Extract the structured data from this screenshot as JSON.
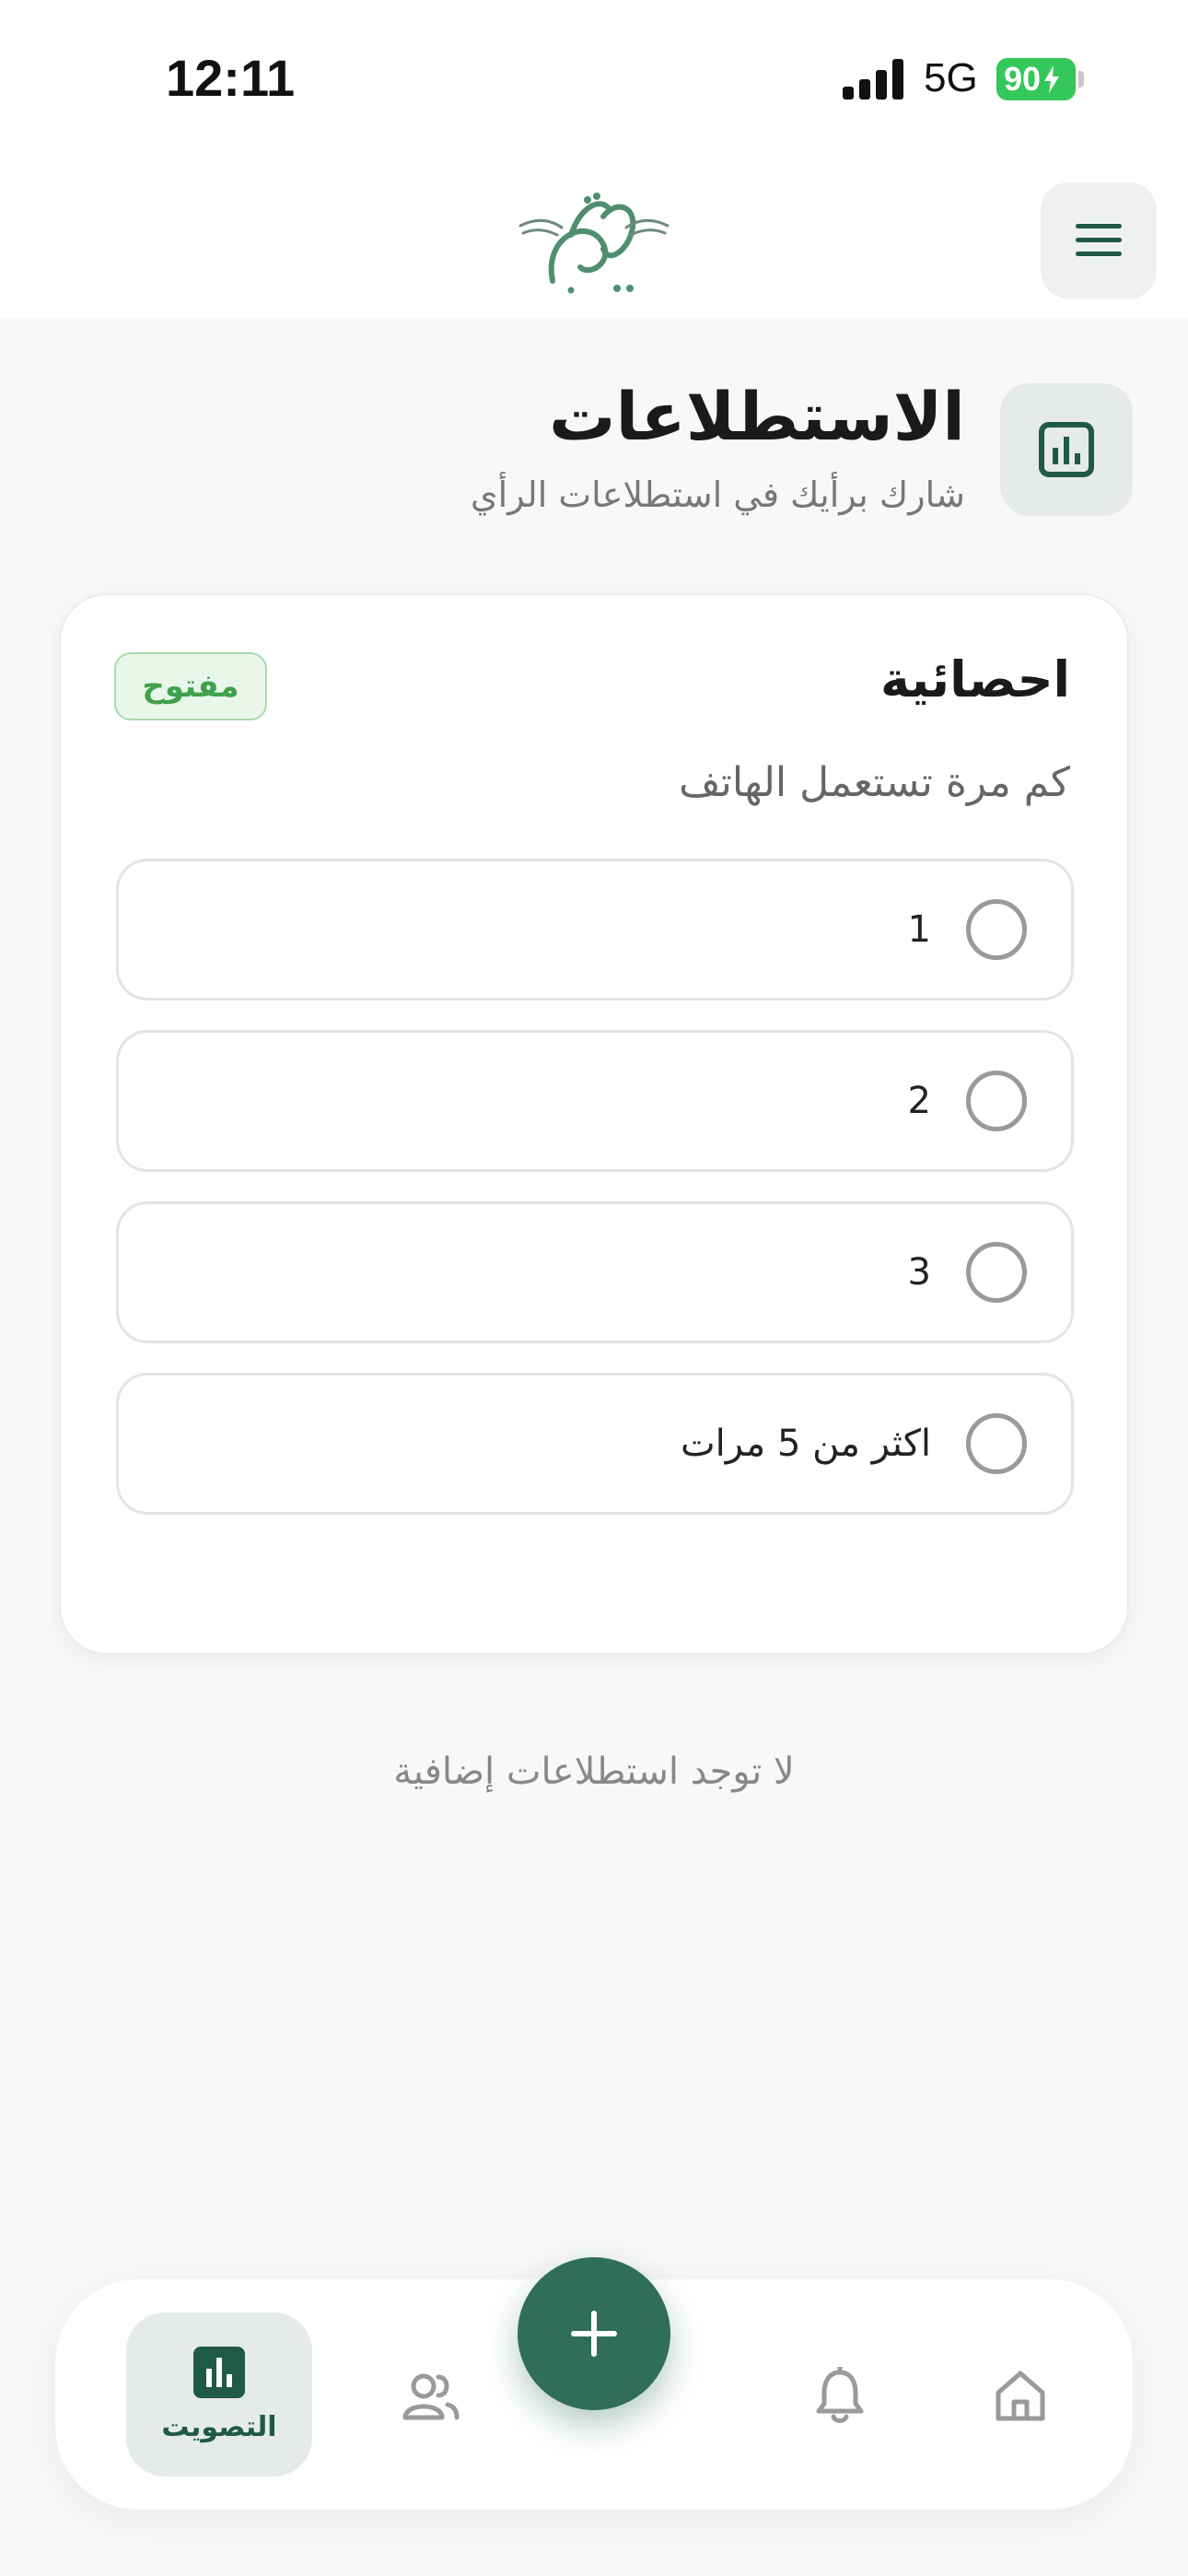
{
  "status_bar": {
    "time": "12:11",
    "network": "5G",
    "battery": "90"
  },
  "header": {
    "logo_icon": "calligraphy-logo",
    "menu_icon": "hamburger-menu-icon"
  },
  "page": {
    "icon": "bar-chart-icon",
    "title": "الاستطلاعات",
    "subtitle": "شارك برأيك في استطلاعات الرأي"
  },
  "poll": {
    "title": "احصائية",
    "status": "مفتوح",
    "question": "كم مرة تستعمل الهاتف",
    "options": [
      {
        "label": "1"
      },
      {
        "label": "2"
      },
      {
        "label": "3"
      },
      {
        "label": "اكثر من 5 مرات"
      }
    ]
  },
  "empty_note": "لا توجد استطلاعات إضافية",
  "bottom_nav": {
    "vote_label": "التصويت",
    "items": [
      "vote",
      "people",
      "add",
      "notifications",
      "home"
    ]
  },
  "colors": {
    "accent": "#2f6e5a",
    "badge_green": "#3fa24a",
    "battery": "#34c759"
  }
}
